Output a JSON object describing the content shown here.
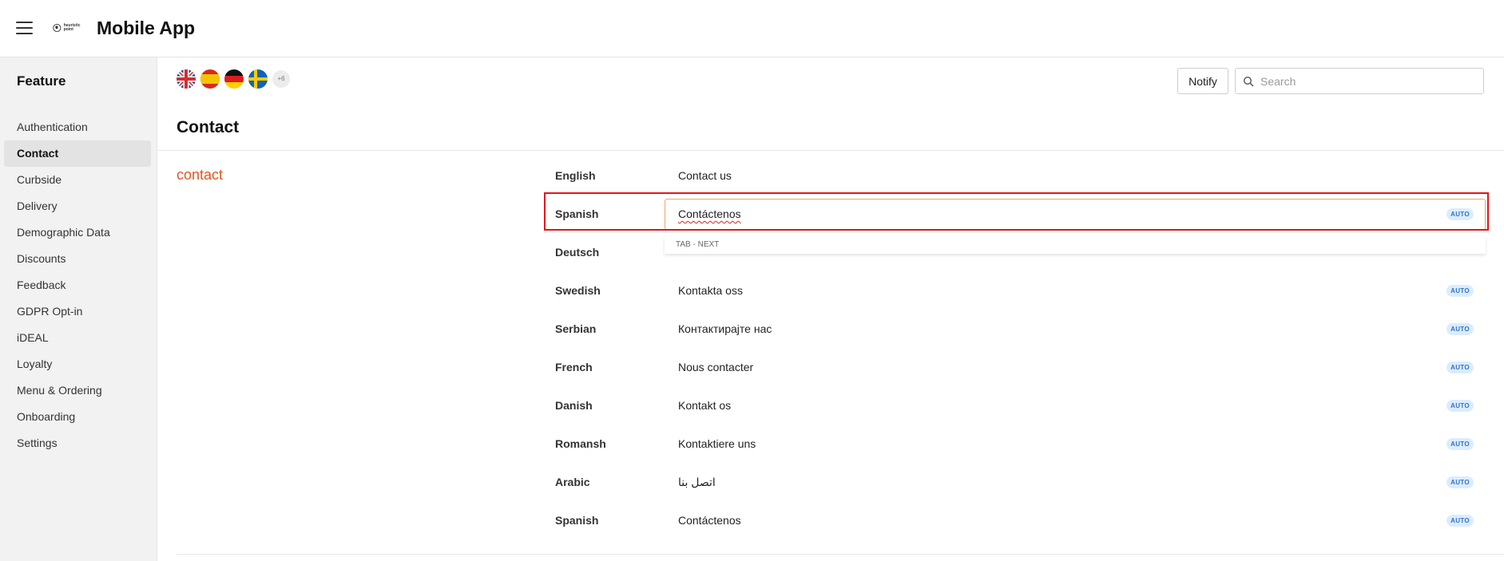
{
  "app": {
    "title": "Mobile App",
    "logo_text": "heuristic point"
  },
  "sidebar": {
    "heading": "Feature",
    "items": [
      {
        "label": "Authentication",
        "active": false
      },
      {
        "label": "Contact",
        "active": true
      },
      {
        "label": "Curbside",
        "active": false
      },
      {
        "label": "Delivery",
        "active": false
      },
      {
        "label": "Demographic Data",
        "active": false
      },
      {
        "label": "Discounts",
        "active": false
      },
      {
        "label": "Feedback",
        "active": false
      },
      {
        "label": "GDPR Opt-in",
        "active": false
      },
      {
        "label": "iDEAL",
        "active": false
      },
      {
        "label": "Loyalty",
        "active": false
      },
      {
        "label": "Menu & Ordering",
        "active": false
      },
      {
        "label": "Onboarding",
        "active": false
      },
      {
        "label": "Settings",
        "active": false
      }
    ]
  },
  "toolbar": {
    "flags": [
      "uk-flag-icon",
      "spain-flag-icon",
      "germany-flag-icon",
      "sweden-flag-icon"
    ],
    "more_flags": "+6",
    "notify_label": "Notify",
    "search_placeholder": "Search",
    "search_value": ""
  },
  "page": {
    "title": "Contact",
    "key": "contact"
  },
  "translations": [
    {
      "language": "English",
      "value": "Contact us",
      "badge": ""
    },
    {
      "language": "Spanish",
      "value": "Contáctenos",
      "badge": "AUTO",
      "editing": true
    },
    {
      "language": "Deutsch",
      "value": "",
      "badge": ""
    },
    {
      "language": "Swedish",
      "value": "Kontakta oss",
      "badge": "AUTO"
    },
    {
      "language": "Serbian",
      "value": "Контактирајте нас",
      "badge": "AUTO"
    },
    {
      "language": "French",
      "value": "Nous contacter",
      "badge": "AUTO"
    },
    {
      "language": "Danish",
      "value": "Kontakt os",
      "badge": "AUTO"
    },
    {
      "language": "Romansh",
      "value": "Kontaktiere uns",
      "badge": "AUTO"
    },
    {
      "language": "Arabic",
      "value": "اتصل بنا",
      "badge": "AUTO"
    },
    {
      "language": "Spanish",
      "value": "Contáctenos",
      "badge": "AUTO"
    }
  ],
  "hint": {
    "text": "TAB - NEXT"
  },
  "colors": {
    "accent": "#e8541e",
    "highlight": "#e4141b",
    "badge_bg": "#dcecff",
    "badge_text": "#2f73d0"
  }
}
